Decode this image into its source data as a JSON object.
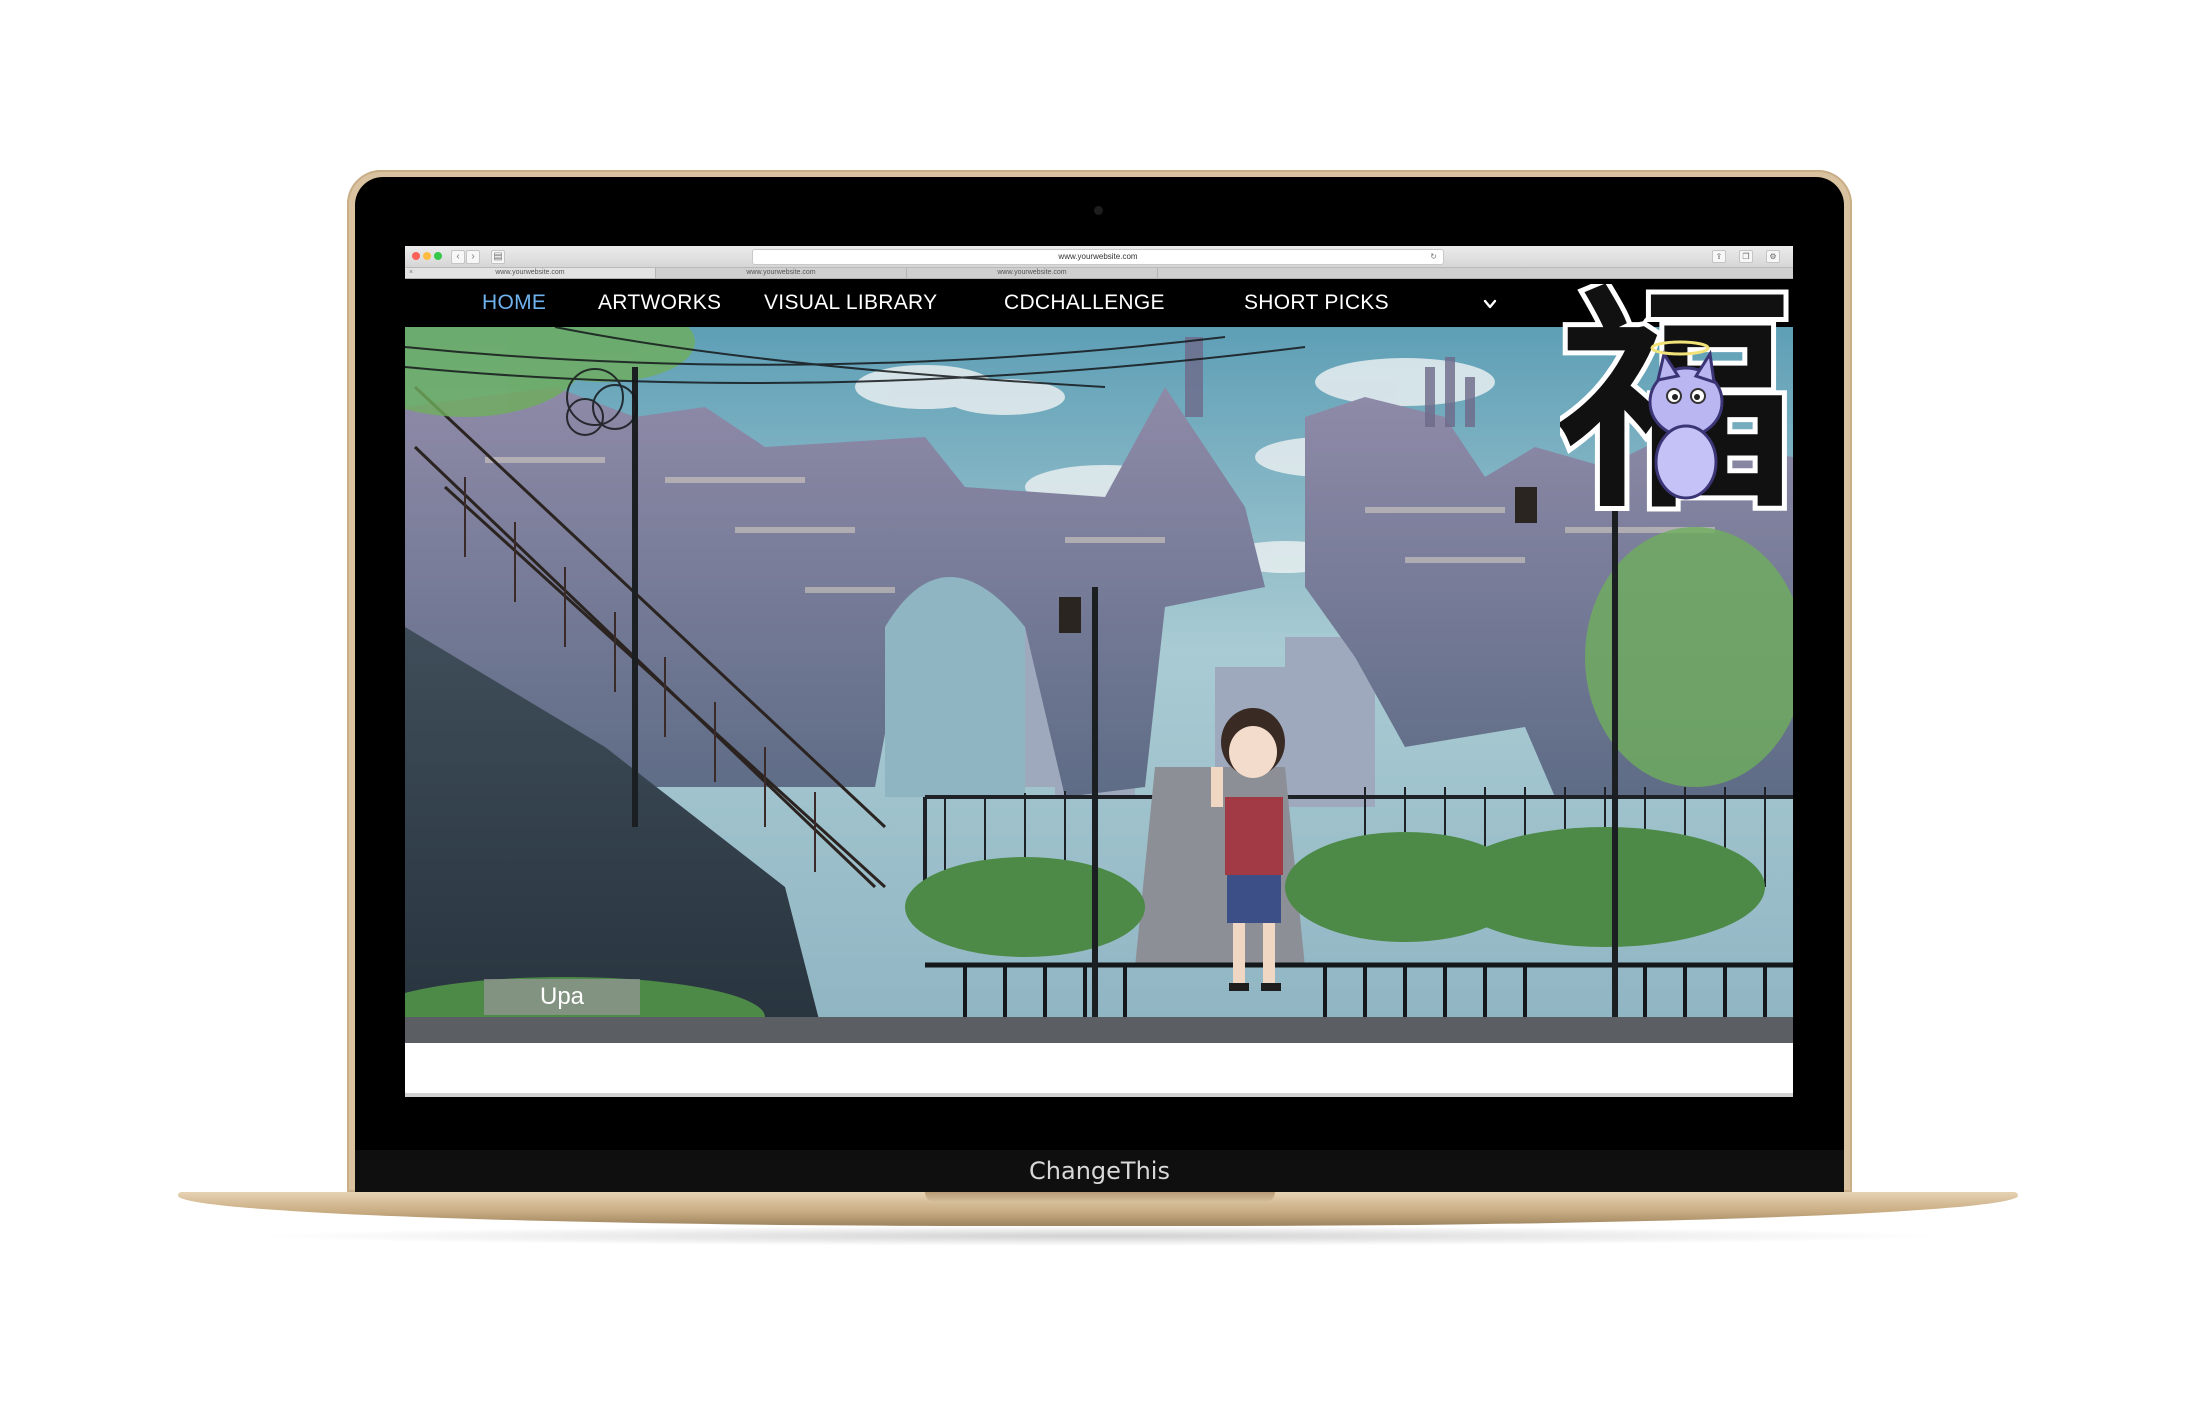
{
  "browser": {
    "url": "www.yourwebsite.com",
    "tabs": [
      "www.yourwebsite.com",
      "www.yourwebsite.com",
      "www.yourwebsite.com"
    ]
  },
  "nav": {
    "items": [
      "HOME",
      "ARTWORKS",
      "VISUAL LIBRARY",
      "CDCHALLENGE",
      "SHORT PICKS"
    ],
    "active_index": 0,
    "menu_icon": "chevron-down-icon"
  },
  "hero": {
    "caption": "Upa"
  },
  "logo": {
    "glyph": "福",
    "icon": "cartoon-cat-logo"
  },
  "device": {
    "brand_label": "ChangeThis"
  },
  "colors": {
    "active_nav": "#6fb2ee",
    "nav_bg": "#000000",
    "laptop_gold": "#d9c2a0"
  }
}
